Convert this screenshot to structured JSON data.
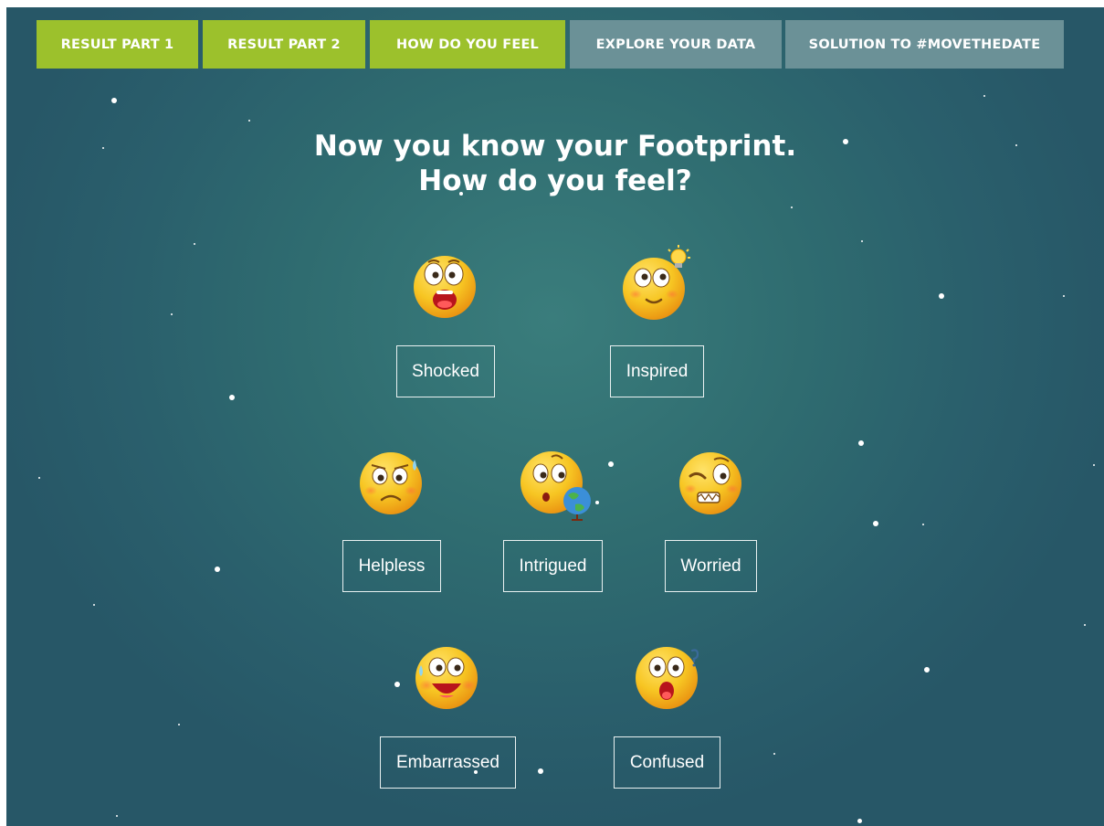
{
  "nav": {
    "tabs": [
      {
        "label": "RESULT PART 1",
        "color": "#9cc12c"
      },
      {
        "label": "RESULT PART 2",
        "color": "#9cc12c"
      },
      {
        "label": "HOW DO YOU FEEL",
        "color": "#9cc12c"
      },
      {
        "label": "EXPLORE YOUR DATA",
        "color": "#6b9197"
      },
      {
        "label": "SOLUTION TO #MOVETHEDATE",
        "color": "#6b9197"
      }
    ]
  },
  "heading": {
    "line1": "Now you know your Footprint.",
    "line2": "How do you feel?"
  },
  "feelings": [
    {
      "label": "Shocked",
      "icon": "shocked-emoji-icon"
    },
    {
      "label": "Inspired",
      "icon": "inspired-emoji-icon"
    },
    {
      "label": "Helpless",
      "icon": "helpless-emoji-icon"
    },
    {
      "label": "Intrigued",
      "icon": "intrigued-emoji-icon"
    },
    {
      "label": "Worried",
      "icon": "worried-emoji-icon"
    },
    {
      "label": "Embarrassed",
      "icon": "embarrassed-emoji-icon"
    },
    {
      "label": "Confused",
      "icon": "confused-emoji-icon"
    }
  ],
  "colors": {
    "background": "#2f6c70",
    "active_tab": "#9cc12c",
    "inactive_tab": "#6b9197",
    "emoji_yellow": "#f7c623"
  }
}
